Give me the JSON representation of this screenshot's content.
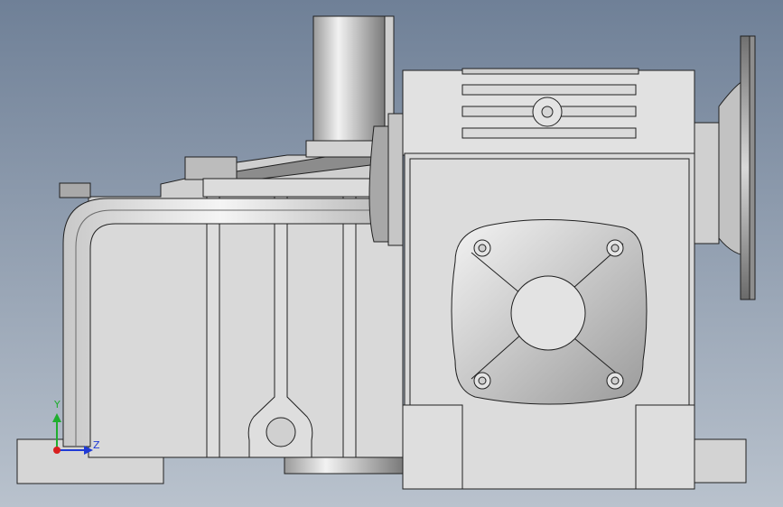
{
  "viewport": {
    "background_top": "#6f8097",
    "background_bottom": "#b9c2cd"
  },
  "model": {
    "edge_color": "#202020",
    "body_fill": "#d8d8d8",
    "light_fill": "#e6e6e6",
    "dark_fill": "#6e6e6e"
  },
  "triad": {
    "y_label": "Y",
    "z_label": "Z",
    "y_color": "#1fae2e",
    "z_color": "#1f3ad6",
    "x_color": "#d81f1f"
  }
}
